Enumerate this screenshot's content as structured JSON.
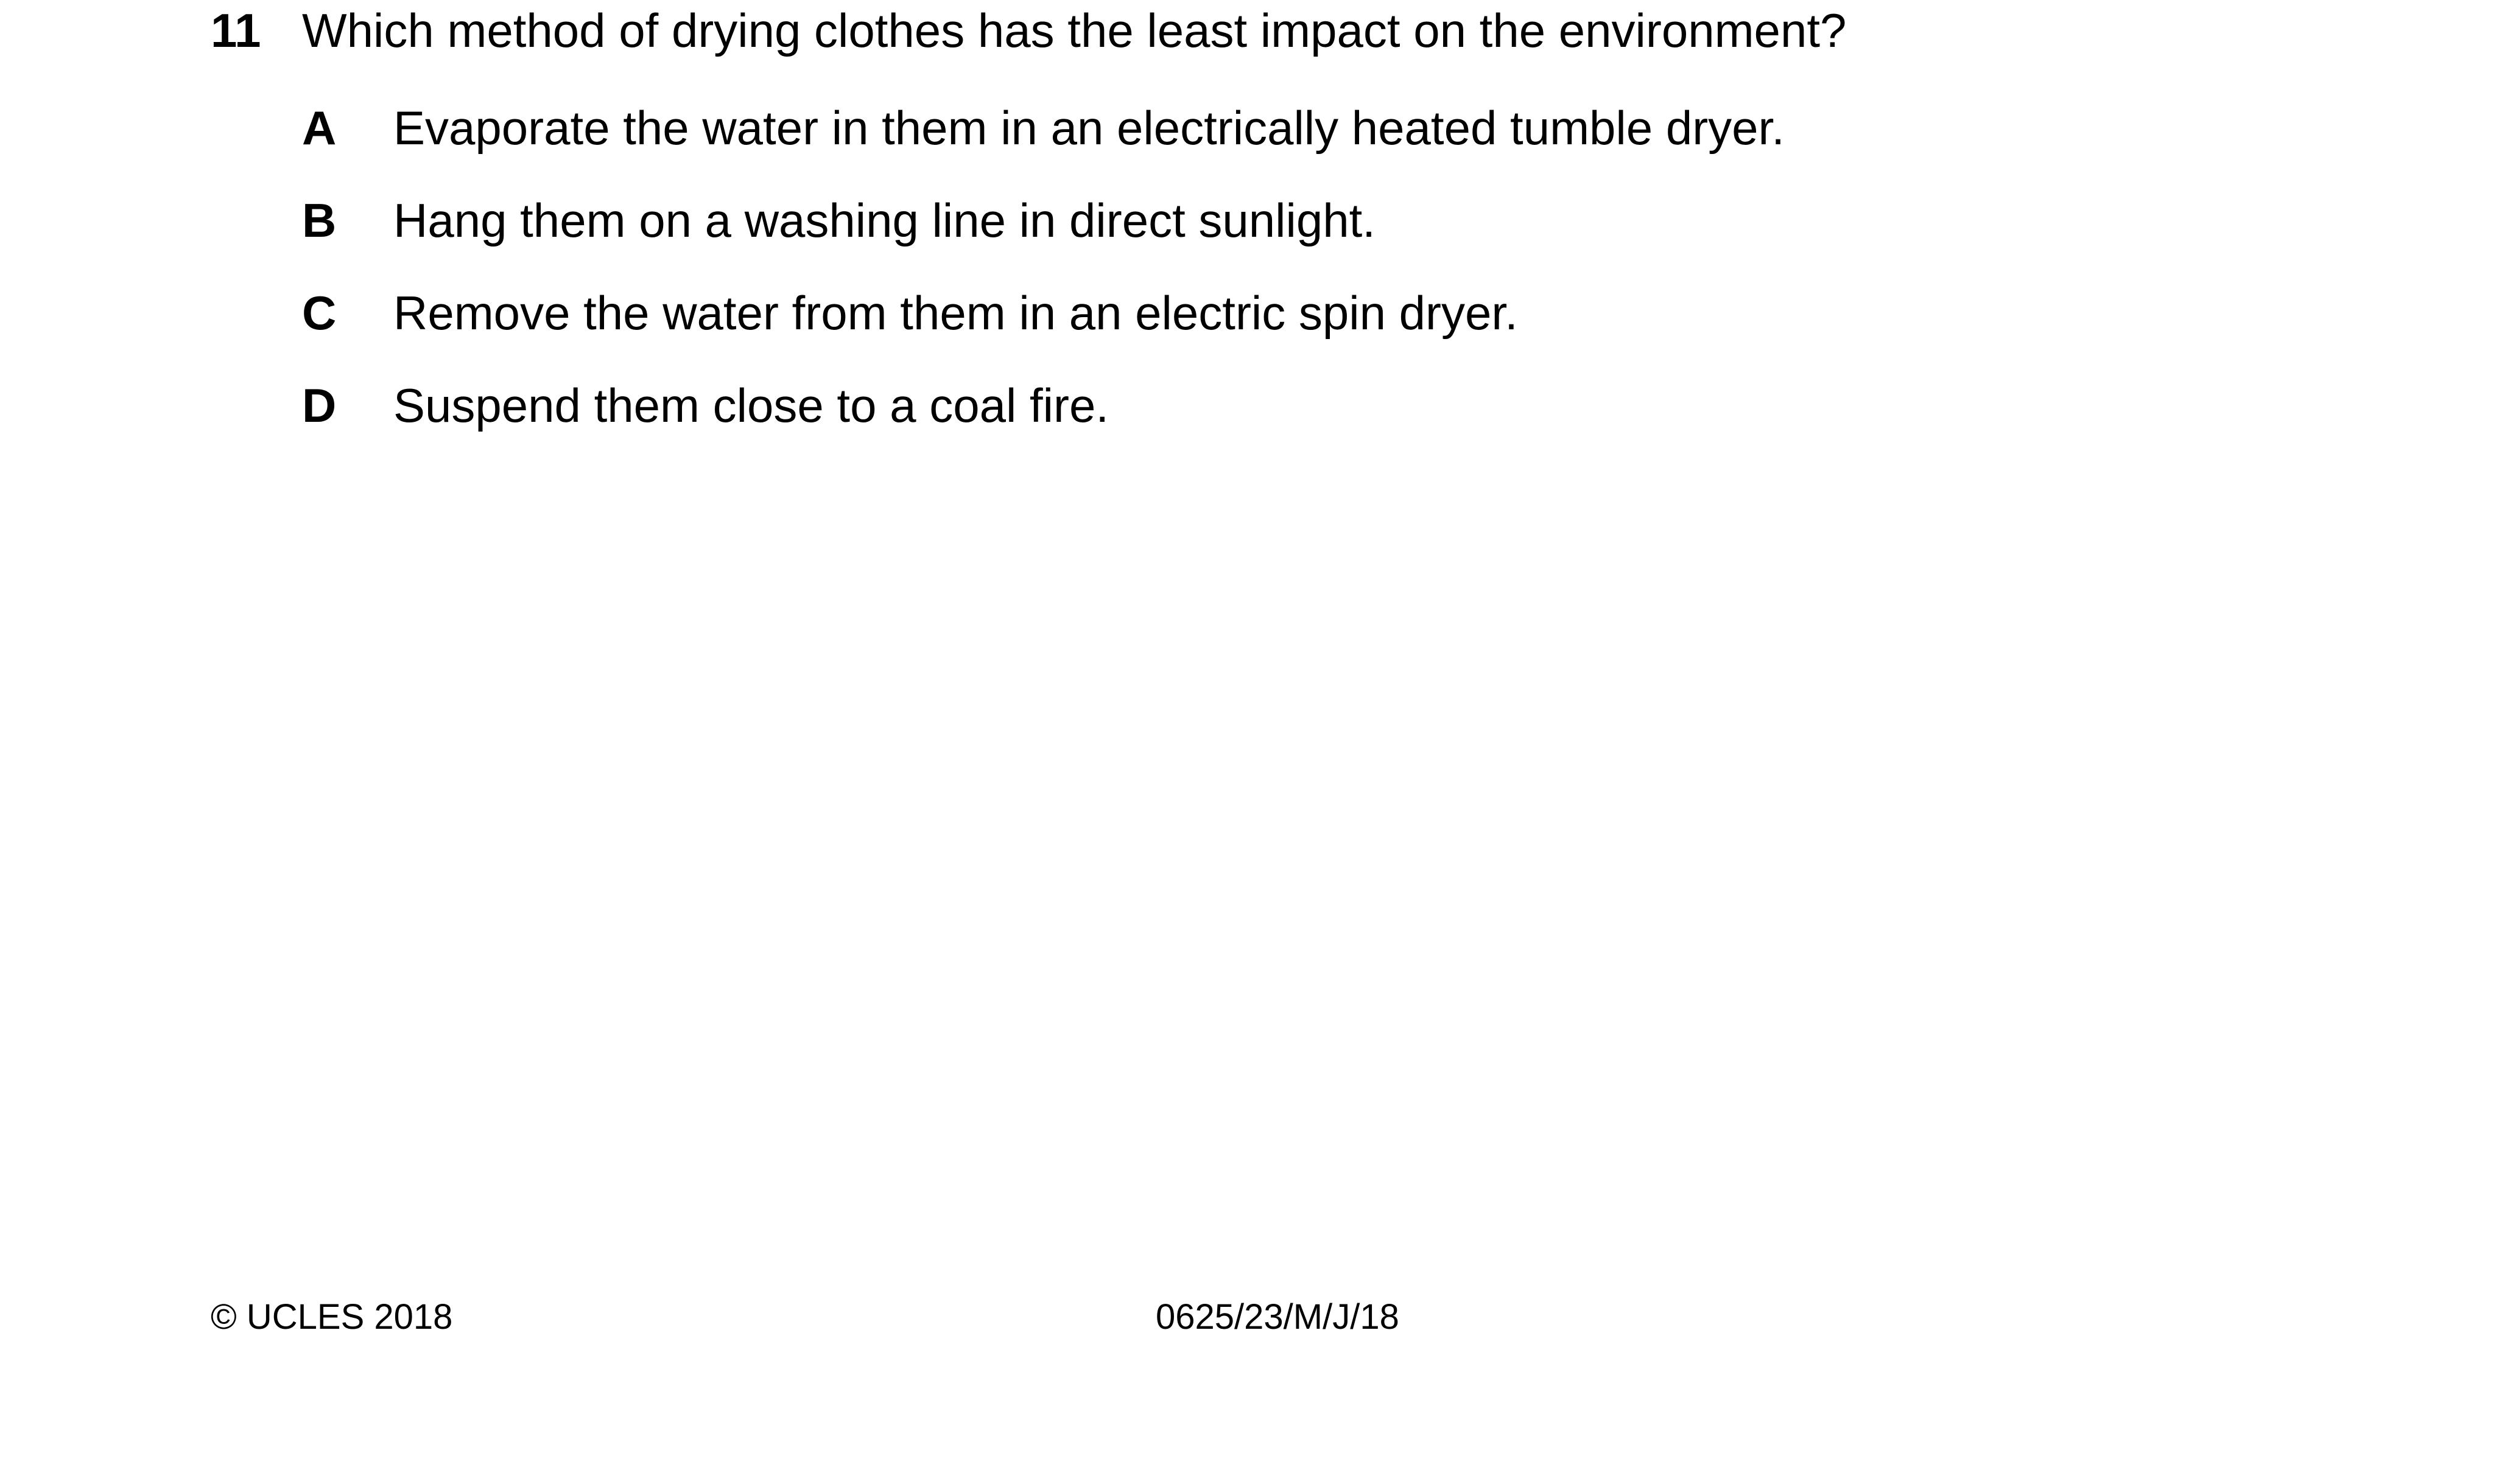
{
  "question": {
    "number": "11",
    "text": "Which method of drying clothes has the least impact on the environment?"
  },
  "options": [
    {
      "letter": "A",
      "text": "Evaporate the water in them in an electrically heated tumble dryer."
    },
    {
      "letter": "B",
      "text": "Hang them on a washing line in direct sunlight."
    },
    {
      "letter": "C",
      "text": "Remove the water from them in an electric spin dryer."
    },
    {
      "letter": "D",
      "text": "Suspend them close to a coal fire."
    }
  ],
  "footer": {
    "copyright": "© UCLES 2018",
    "paper_code": "0625/23/M/J/18"
  }
}
